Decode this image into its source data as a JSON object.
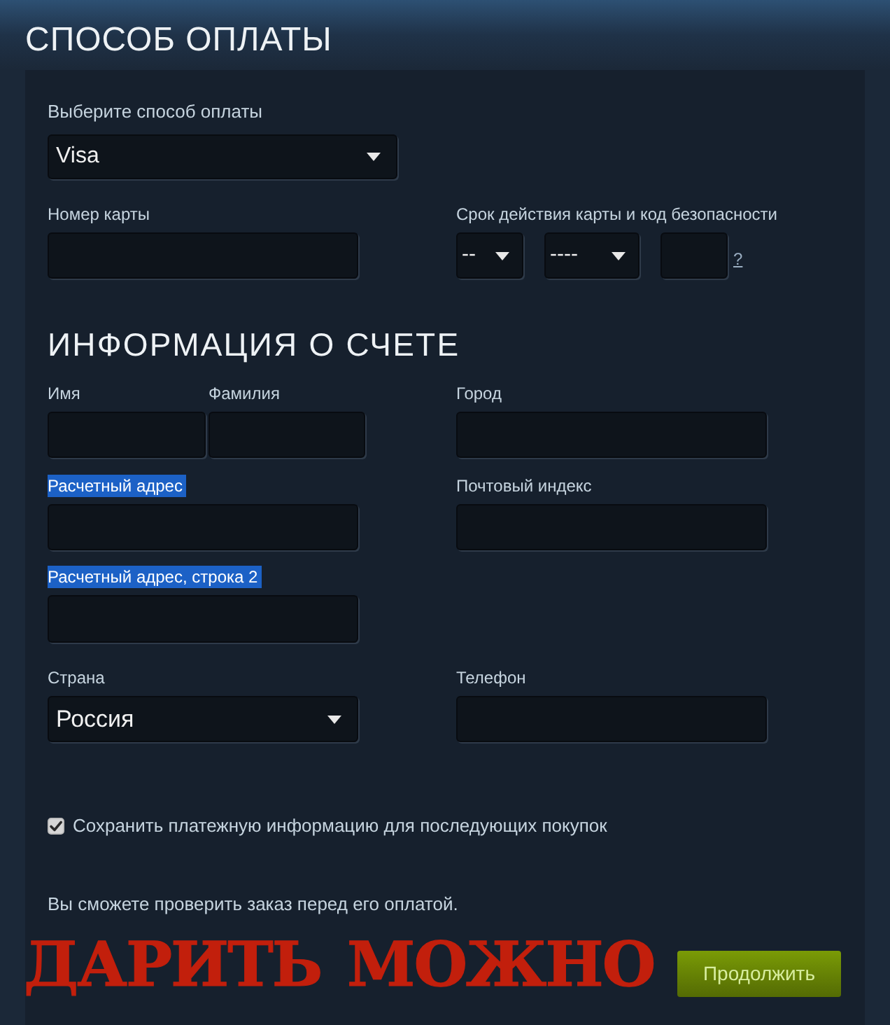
{
  "payment_section": {
    "title": "СПОСОБ ОПЛАТЫ",
    "payment_method": {
      "label": "Выберите способ оплаты",
      "value": "Visa"
    },
    "card_number": {
      "label": "Номер карты"
    },
    "card_expiry": {
      "label": "Срок действия карты и код безопасности",
      "month": "--",
      "year": "----",
      "help_link": "?"
    }
  },
  "billing_section": {
    "title": "ИНФОРМАЦИЯ О СЧЕТЕ",
    "first_name": {
      "label": "Имя",
      "highlighted": false
    },
    "last_name": {
      "label": "Фамилия",
      "highlighted": false
    },
    "city": {
      "label": "Город",
      "highlighted": false
    },
    "billing_address": {
      "label": "Расчетный адрес",
      "highlighted": true
    },
    "postal_code": {
      "label": "Почтовый индекс",
      "highlighted": false
    },
    "billing_address_line_2": {
      "label": "Расчетный адрес, строка 2",
      "highlighted": true
    },
    "country": {
      "label": "Страна",
      "value": "Россия",
      "highlighted": false
    },
    "phone": {
      "label": "Телефон",
      "highlighted": false
    }
  },
  "save_payment_info": {
    "label": "Сохранить платежную информацию для последующих покупок",
    "checked": true
  },
  "note": "Вы сможете проверить заказ перед его оплатой.",
  "continue_button": "Продолжить",
  "overlay_caption": "ДАРИТЬ МОЖНО"
}
